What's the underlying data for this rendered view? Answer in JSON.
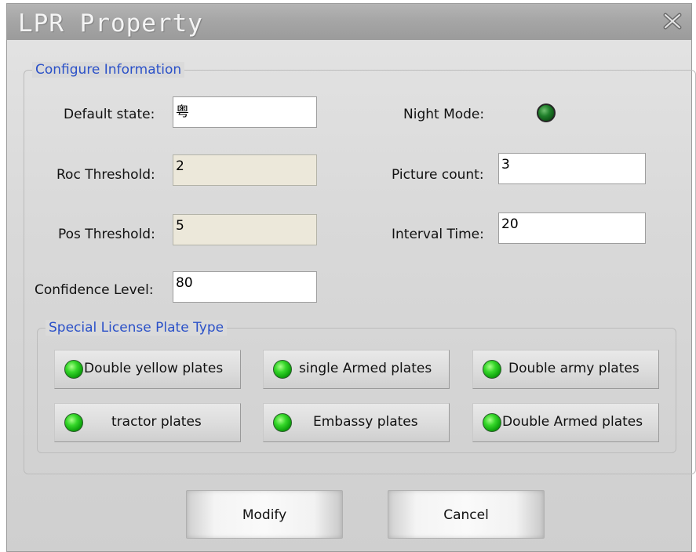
{
  "window": {
    "title": "LPR Property",
    "close_icon": "close-icon"
  },
  "config": {
    "legend": "Configure Information",
    "default_state": {
      "label": "Default state:",
      "value": "粤"
    },
    "roc_threshold": {
      "label": "Roc Threshold:",
      "value": "2"
    },
    "pos_threshold": {
      "label": "Pos Threshold:",
      "value": "5"
    },
    "confidence_level": {
      "label": "Confidence Level:",
      "value": "80"
    },
    "night_mode": {
      "label": "Night Mode:",
      "state": "off"
    },
    "picture_count": {
      "label": "Picture count:",
      "value": "3"
    },
    "interval_time": {
      "label": "Interval Time:",
      "value": "20"
    }
  },
  "plates": {
    "legend": "Special License Plate Type",
    "items": [
      {
        "label": "Double yellow plates",
        "state": "on"
      },
      {
        "label": "single Armed plates",
        "state": "on"
      },
      {
        "label": "Double army plates",
        "state": "on"
      },
      {
        "label": "tractor plates",
        "state": "on"
      },
      {
        "label": "Embassy plates",
        "state": "on"
      },
      {
        "label": "Double Armed plates",
        "state": "on"
      }
    ]
  },
  "actions": {
    "modify": "Modify",
    "cancel": "Cancel"
  },
  "colors": {
    "legend_text": "#2b51c8",
    "led_on": "#36d72a",
    "led_night": "#1f7f2a"
  }
}
